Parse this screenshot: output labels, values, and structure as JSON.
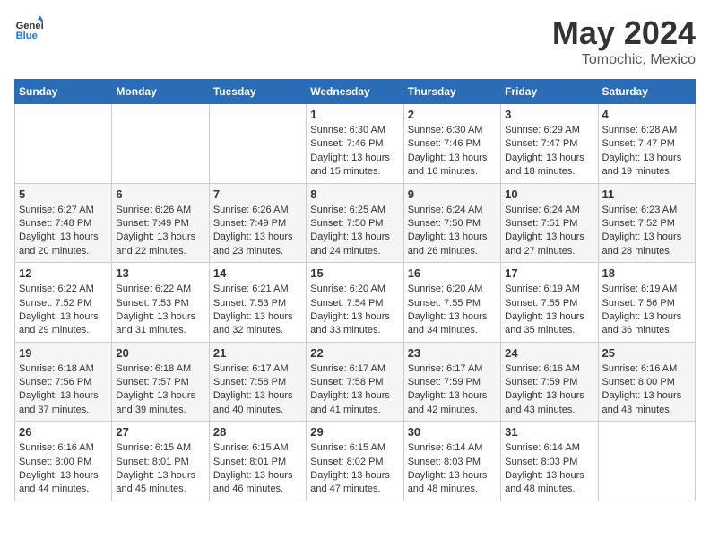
{
  "header": {
    "logo_general": "General",
    "logo_blue": "Blue",
    "month_year": "May 2024",
    "location": "Tomochic, Mexico"
  },
  "days_of_week": [
    "Sunday",
    "Monday",
    "Tuesday",
    "Wednesday",
    "Thursday",
    "Friday",
    "Saturday"
  ],
  "weeks": [
    [
      {
        "day": "",
        "sunrise": "",
        "sunset": "",
        "daylight": ""
      },
      {
        "day": "",
        "sunrise": "",
        "sunset": "",
        "daylight": ""
      },
      {
        "day": "",
        "sunrise": "",
        "sunset": "",
        "daylight": ""
      },
      {
        "day": "1",
        "sunrise": "Sunrise: 6:30 AM",
        "sunset": "Sunset: 7:46 PM",
        "daylight": "Daylight: 13 hours and 15 minutes."
      },
      {
        "day": "2",
        "sunrise": "Sunrise: 6:30 AM",
        "sunset": "Sunset: 7:46 PM",
        "daylight": "Daylight: 13 hours and 16 minutes."
      },
      {
        "day": "3",
        "sunrise": "Sunrise: 6:29 AM",
        "sunset": "Sunset: 7:47 PM",
        "daylight": "Daylight: 13 hours and 18 minutes."
      },
      {
        "day": "4",
        "sunrise": "Sunrise: 6:28 AM",
        "sunset": "Sunset: 7:47 PM",
        "daylight": "Daylight: 13 hours and 19 minutes."
      }
    ],
    [
      {
        "day": "5",
        "sunrise": "Sunrise: 6:27 AM",
        "sunset": "Sunset: 7:48 PM",
        "daylight": "Daylight: 13 hours and 20 minutes."
      },
      {
        "day": "6",
        "sunrise": "Sunrise: 6:26 AM",
        "sunset": "Sunset: 7:49 PM",
        "daylight": "Daylight: 13 hours and 22 minutes."
      },
      {
        "day": "7",
        "sunrise": "Sunrise: 6:26 AM",
        "sunset": "Sunset: 7:49 PM",
        "daylight": "Daylight: 13 hours and 23 minutes."
      },
      {
        "day": "8",
        "sunrise": "Sunrise: 6:25 AM",
        "sunset": "Sunset: 7:50 PM",
        "daylight": "Daylight: 13 hours and 24 minutes."
      },
      {
        "day": "9",
        "sunrise": "Sunrise: 6:24 AM",
        "sunset": "Sunset: 7:50 PM",
        "daylight": "Daylight: 13 hours and 26 minutes."
      },
      {
        "day": "10",
        "sunrise": "Sunrise: 6:24 AM",
        "sunset": "Sunset: 7:51 PM",
        "daylight": "Daylight: 13 hours and 27 minutes."
      },
      {
        "day": "11",
        "sunrise": "Sunrise: 6:23 AM",
        "sunset": "Sunset: 7:52 PM",
        "daylight": "Daylight: 13 hours and 28 minutes."
      }
    ],
    [
      {
        "day": "12",
        "sunrise": "Sunrise: 6:22 AM",
        "sunset": "Sunset: 7:52 PM",
        "daylight": "Daylight: 13 hours and 29 minutes."
      },
      {
        "day": "13",
        "sunrise": "Sunrise: 6:22 AM",
        "sunset": "Sunset: 7:53 PM",
        "daylight": "Daylight: 13 hours and 31 minutes."
      },
      {
        "day": "14",
        "sunrise": "Sunrise: 6:21 AM",
        "sunset": "Sunset: 7:53 PM",
        "daylight": "Daylight: 13 hours and 32 minutes."
      },
      {
        "day": "15",
        "sunrise": "Sunrise: 6:20 AM",
        "sunset": "Sunset: 7:54 PM",
        "daylight": "Daylight: 13 hours and 33 minutes."
      },
      {
        "day": "16",
        "sunrise": "Sunrise: 6:20 AM",
        "sunset": "Sunset: 7:55 PM",
        "daylight": "Daylight: 13 hours and 34 minutes."
      },
      {
        "day": "17",
        "sunrise": "Sunrise: 6:19 AM",
        "sunset": "Sunset: 7:55 PM",
        "daylight": "Daylight: 13 hours and 35 minutes."
      },
      {
        "day": "18",
        "sunrise": "Sunrise: 6:19 AM",
        "sunset": "Sunset: 7:56 PM",
        "daylight": "Daylight: 13 hours and 36 minutes."
      }
    ],
    [
      {
        "day": "19",
        "sunrise": "Sunrise: 6:18 AM",
        "sunset": "Sunset: 7:56 PM",
        "daylight": "Daylight: 13 hours and 37 minutes."
      },
      {
        "day": "20",
        "sunrise": "Sunrise: 6:18 AM",
        "sunset": "Sunset: 7:57 PM",
        "daylight": "Daylight: 13 hours and 39 minutes."
      },
      {
        "day": "21",
        "sunrise": "Sunrise: 6:17 AM",
        "sunset": "Sunset: 7:58 PM",
        "daylight": "Daylight: 13 hours and 40 minutes."
      },
      {
        "day": "22",
        "sunrise": "Sunrise: 6:17 AM",
        "sunset": "Sunset: 7:58 PM",
        "daylight": "Daylight: 13 hours and 41 minutes."
      },
      {
        "day": "23",
        "sunrise": "Sunrise: 6:17 AM",
        "sunset": "Sunset: 7:59 PM",
        "daylight": "Daylight: 13 hours and 42 minutes."
      },
      {
        "day": "24",
        "sunrise": "Sunrise: 6:16 AM",
        "sunset": "Sunset: 7:59 PM",
        "daylight": "Daylight: 13 hours and 43 minutes."
      },
      {
        "day": "25",
        "sunrise": "Sunrise: 6:16 AM",
        "sunset": "Sunset: 8:00 PM",
        "daylight": "Daylight: 13 hours and 43 minutes."
      }
    ],
    [
      {
        "day": "26",
        "sunrise": "Sunrise: 6:16 AM",
        "sunset": "Sunset: 8:00 PM",
        "daylight": "Daylight: 13 hours and 44 minutes."
      },
      {
        "day": "27",
        "sunrise": "Sunrise: 6:15 AM",
        "sunset": "Sunset: 8:01 PM",
        "daylight": "Daylight: 13 hours and 45 minutes."
      },
      {
        "day": "28",
        "sunrise": "Sunrise: 6:15 AM",
        "sunset": "Sunset: 8:01 PM",
        "daylight": "Daylight: 13 hours and 46 minutes."
      },
      {
        "day": "29",
        "sunrise": "Sunrise: 6:15 AM",
        "sunset": "Sunset: 8:02 PM",
        "daylight": "Daylight: 13 hours and 47 minutes."
      },
      {
        "day": "30",
        "sunrise": "Sunrise: 6:14 AM",
        "sunset": "Sunset: 8:03 PM",
        "daylight": "Daylight: 13 hours and 48 minutes."
      },
      {
        "day": "31",
        "sunrise": "Sunrise: 6:14 AM",
        "sunset": "Sunset: 8:03 PM",
        "daylight": "Daylight: 13 hours and 48 minutes."
      },
      {
        "day": "",
        "sunrise": "",
        "sunset": "",
        "daylight": ""
      }
    ]
  ]
}
